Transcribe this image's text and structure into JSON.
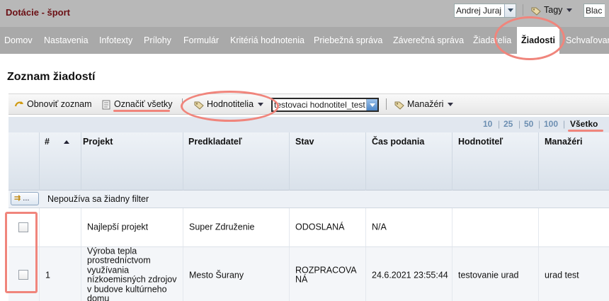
{
  "app": {
    "title": "Dotácie - šport"
  },
  "nav": {
    "items": [
      {
        "label": "Domov"
      },
      {
        "label": "Nastavenia"
      },
      {
        "label": "Infotexty"
      },
      {
        "label": "Prílohy"
      },
      {
        "label": "Formulár"
      },
      {
        "label": "Kritériá hodnotenia"
      },
      {
        "label": "Priebežná správa"
      },
      {
        "label": "Záverečná správa"
      },
      {
        "label": "Žiadatelia"
      },
      {
        "label": "Žiadosti",
        "active": true
      },
      {
        "label": "Schvaľovan"
      }
    ]
  },
  "page": {
    "title": "Zoznam žiadostí"
  },
  "toolbar": {
    "refresh_label": "Obnoviť zoznam",
    "select_all_label": "Označiť všetky",
    "evaluators_label": "Hodnotitelia",
    "evaluator_value": "testovaci hodnotitel_test",
    "managers_label": "Manažéri",
    "manager_value": "Andrej Juraj",
    "tags_label": "Tagy",
    "tags_value": "Blac"
  },
  "pager": {
    "options": [
      "10",
      "25",
      "50",
      "100",
      "Všetko"
    ],
    "separator": "|",
    "current": "Všetko"
  },
  "table": {
    "columns": [
      "#",
      "Projekt",
      "Predkladateľ",
      "Stav",
      "Čas podania",
      "Hodnotiteľ",
      "Manažéri"
    ],
    "filter_button": "...",
    "filter_text": "Nepoužíva sa žiadny filter",
    "rows": [
      {
        "num": "",
        "project": "Najlepší projekt",
        "applicant": "Super Združenie",
        "status": "ODOSLANÁ",
        "submitted": "N/A",
        "evaluator": "",
        "managers": ""
      },
      {
        "num": "1",
        "project": "Výroba tepla prostredníctvom využívania nízkoemisných zdrojov v budove kultúrneho domu",
        "applicant": "Mesto Šurany",
        "status": "ROZPRACOVANÁ",
        "submitted": "24.6.2021 23:55:44",
        "evaluator": "testovanie urad",
        "managers": "urad test"
      }
    ]
  },
  "colors": {
    "accent": "#f0857c",
    "title": "#6b0f14",
    "nav_bg": "#a9a9a9",
    "pager_link": "#6d8fb2"
  },
  "icons": {
    "refresh": "refresh-arrow-icon",
    "select_all": "document-icon",
    "tag": "tag-icon",
    "filter": "filter-arrows-icon"
  }
}
